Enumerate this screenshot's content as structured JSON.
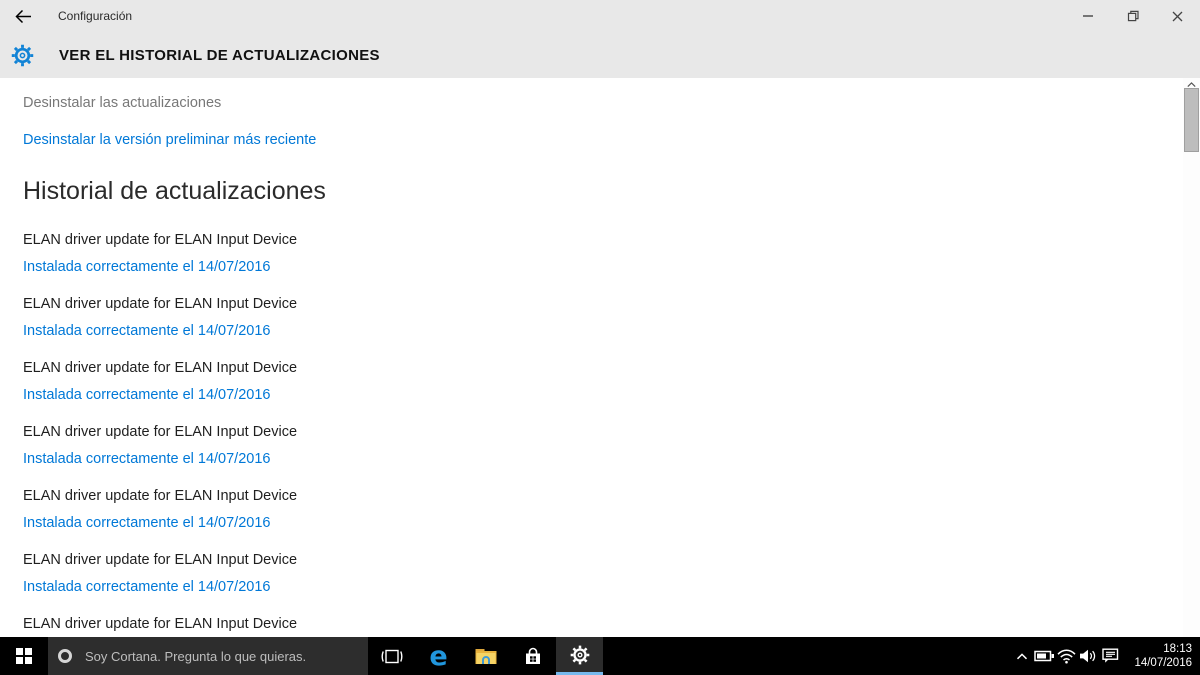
{
  "titlebar": {
    "title": "Configuración"
  },
  "header": {
    "title": "VER EL HISTORIAL DE ACTUALIZACIONES"
  },
  "content": {
    "uninstall_updates_link": "Desinstalar las actualizaciones",
    "uninstall_preview_link": "Desinstalar la versión preliminar más reciente",
    "history_heading": "Historial de actualizaciones",
    "updates": [
      {
        "title": "ELAN driver update for ELAN Input Device",
        "status": "Instalada correctamente el 14/07/2016"
      },
      {
        "title": "ELAN driver update for ELAN Input Device",
        "status": "Instalada correctamente el 14/07/2016"
      },
      {
        "title": "ELAN driver update for ELAN Input Device",
        "status": "Instalada correctamente el 14/07/2016"
      },
      {
        "title": "ELAN driver update for ELAN Input Device",
        "status": "Instalada correctamente el 14/07/2016"
      },
      {
        "title": "ELAN driver update for ELAN Input Device",
        "status": "Instalada correctamente el 14/07/2016"
      },
      {
        "title": "ELAN driver update for ELAN Input Device",
        "status": "Instalada correctamente el 14/07/2016"
      },
      {
        "title": "ELAN driver update for ELAN Input Device"
      }
    ]
  },
  "taskbar": {
    "search_placeholder": "Soy Cortana. Pregunta lo que quieras.",
    "edge_icon_glyph": "e",
    "clock": {
      "time": "18:13",
      "date": "14/07/2016"
    }
  },
  "colors": {
    "accent_blue": "#0078d7",
    "header_bg": "#e8e8e8",
    "taskbar_bg": "#000000",
    "search_box_bg": "#2d2d2d",
    "active_app_underline": "#76b9ed",
    "gray_link": "#787878"
  },
  "icons": {
    "back": "arrow-left",
    "header_gear": "gear-outline-blue",
    "window_controls": [
      "minimize",
      "restore",
      "close"
    ],
    "start": "windows-logo",
    "cortana": "ring-circle",
    "task_view": "bracketed-rectangle",
    "edge": "blue-e",
    "file_explorer": "yellow-folder",
    "store": "shopping-bag",
    "tray": [
      "chevron-up",
      "battery",
      "wifi",
      "speaker",
      "action-center"
    ]
  }
}
